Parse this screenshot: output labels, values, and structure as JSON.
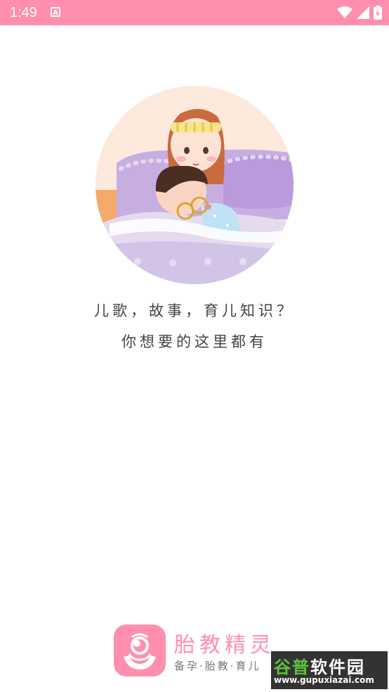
{
  "status_bar": {
    "time": "1:49",
    "notification_icon": "a-notification-icon",
    "icons": [
      "wifi-icon",
      "cell-signal-icon",
      "battery-icon"
    ]
  },
  "illustration": {
    "subject": "mother-and-child-in-bed"
  },
  "tagline": {
    "line1": "儿歌，故事，育儿知识？",
    "line2": "你想要的这里都有"
  },
  "brand": {
    "name": "胎教精灵",
    "slogan": "备孕·胎教·育儿"
  },
  "watermark": {
    "title_part1": "谷普",
    "title_part2": "软件园",
    "url": "www.gupuxiazai.com"
  },
  "colors": {
    "accent": "#ff8fad",
    "watermark_green": "#5cc43a"
  }
}
